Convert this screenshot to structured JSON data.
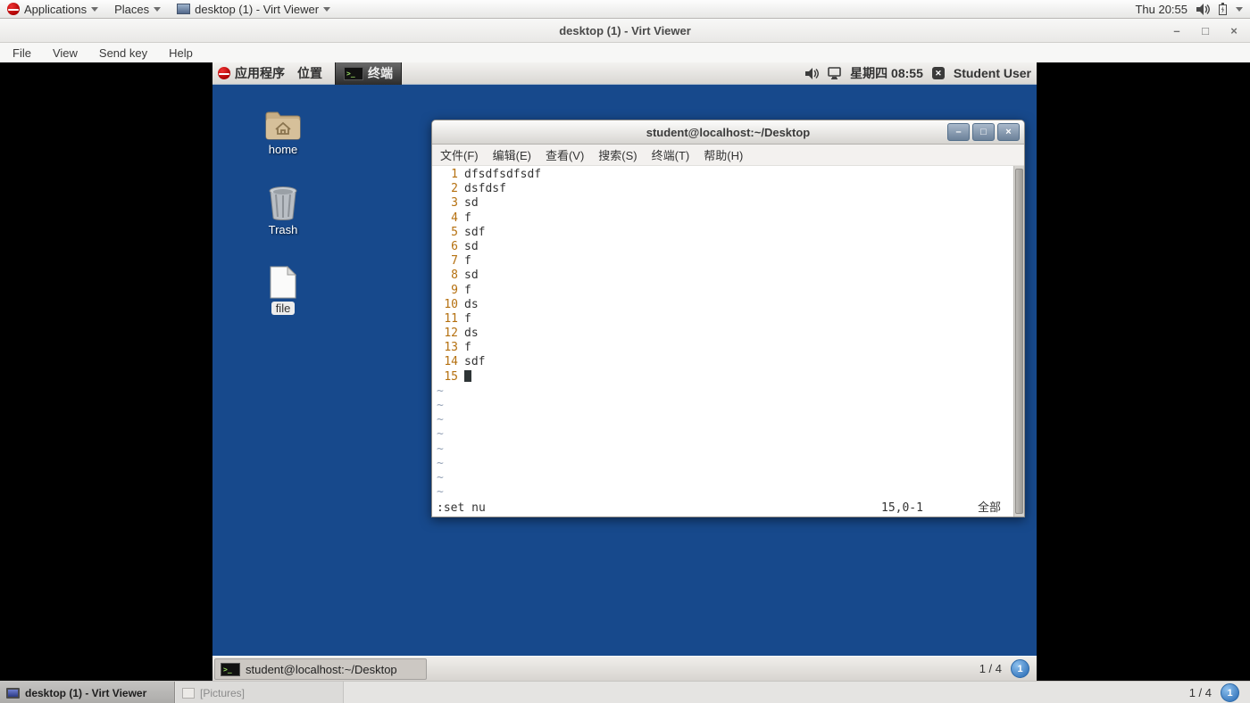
{
  "host_topbar": {
    "applications_label": "Applications",
    "places_label": "Places",
    "window_button_label": "desktop (1) - Virt Viewer",
    "clock": "Thu 20:55"
  },
  "viewer_window": {
    "title": "desktop (1) - Virt Viewer",
    "menus": [
      "File",
      "View",
      "Send key",
      "Help"
    ],
    "controls": {
      "minimize": "–",
      "maximize": "□",
      "close": "×"
    }
  },
  "guest": {
    "panel": {
      "applications_label": "应用程序",
      "places_label": "位置",
      "terminal_task_label": "终端",
      "datetime": "星期四 08:55",
      "user": "Student User"
    },
    "desktop_icons": [
      {
        "label": "home"
      },
      {
        "label": "Trash"
      },
      {
        "label": "file"
      }
    ],
    "taskbar": {
      "task_label": "student@localhost:~/Desktop",
      "pager": "1 / 4",
      "workspace_badge": "1"
    }
  },
  "terminal": {
    "title": "student@localhost:~/Desktop",
    "menus": [
      "文件(F)",
      "编辑(E)",
      "查看(V)",
      "搜索(S)",
      "终端(T)",
      "帮助(H)"
    ],
    "controls": {
      "minimize": "–",
      "maximize": "□",
      "close": "×"
    },
    "vim": {
      "lines": [
        {
          "num": "1",
          "text": "dfsdfsdfsdf"
        },
        {
          "num": "2",
          "text": "dsfdsf"
        },
        {
          "num": "3",
          "text": "sd"
        },
        {
          "num": "4",
          "text": "f"
        },
        {
          "num": "5",
          "text": "sdf"
        },
        {
          "num": "6",
          "text": "sd"
        },
        {
          "num": "7",
          "text": "f"
        },
        {
          "num": "8",
          "text": "sd"
        },
        {
          "num": "9",
          "text": "f"
        },
        {
          "num": "10",
          "text": "ds"
        },
        {
          "num": "11",
          "text": "f"
        },
        {
          "num": "12",
          "text": "ds"
        },
        {
          "num": "13",
          "text": "f"
        },
        {
          "num": "14",
          "text": "sdf"
        },
        {
          "num": "15",
          "text": ""
        }
      ],
      "tilde_char": "~",
      "tilde_count": 8,
      "status": {
        "command": ":set nu",
        "position": "15,0-1",
        "scope": "全部"
      }
    }
  },
  "host_taskbar": {
    "active_task": "desktop (1) - Virt Viewer",
    "inactive_task": "[Pictures]",
    "pager": "1 / 4",
    "workspace_badge": "1"
  },
  "colors": {
    "desktop_blue": "#17498c",
    "vim_line_number": "#b5700f",
    "vim_tilde": "#93a1b5",
    "titlebar_button_blue": "#6c8199",
    "workspace_badge_blue": "#3d7cc0"
  }
}
